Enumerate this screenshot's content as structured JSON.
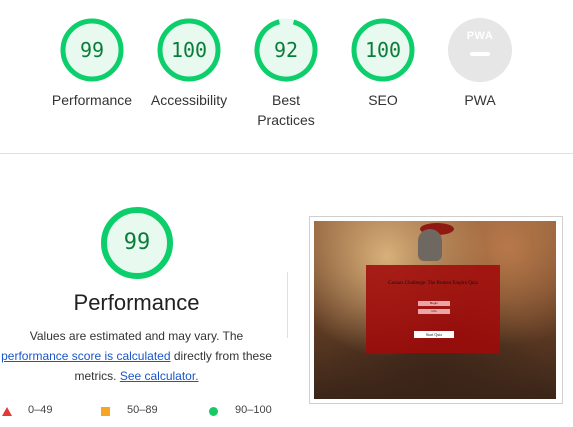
{
  "summary": {
    "gauges": [
      {
        "score": "99",
        "label": "Performance"
      },
      {
        "score": "100",
        "label": "Accessibility"
      },
      {
        "score": "92",
        "label": "Best Practices"
      },
      {
        "score": "100",
        "label": "SEO"
      },
      {
        "badge": "PWA",
        "label": "PWA"
      }
    ]
  },
  "performance": {
    "score": "99",
    "title": "Performance",
    "desc_line1": "Values are estimated and may vary. The",
    "score_link": "performance score is calculated",
    "desc_line2_rest": " directly from these",
    "desc_line3_start": "metrics. ",
    "calculator_link": "See calculator."
  },
  "legend": [
    {
      "range": "0–49",
      "icon": "red-triangle-icon"
    },
    {
      "range": "50–89",
      "icon": "orange-square-icon"
    },
    {
      "range": "90–100",
      "icon": "green-circle-icon"
    }
  ],
  "screenshot": {
    "quiz_title": "Caesars Challenge: The Roman Empire Quiz",
    "option_1": "Begin",
    "option_2": "Info",
    "start_button": "Start Quiz"
  },
  "colors": {
    "pass_green": "#0cce6b",
    "pass_text": "#0b7d3a",
    "pass_fill": "#e8f9ef",
    "average_orange": "#f5a623",
    "fail_red": "#e53935",
    "link_blue": "#1a55c9"
  }
}
